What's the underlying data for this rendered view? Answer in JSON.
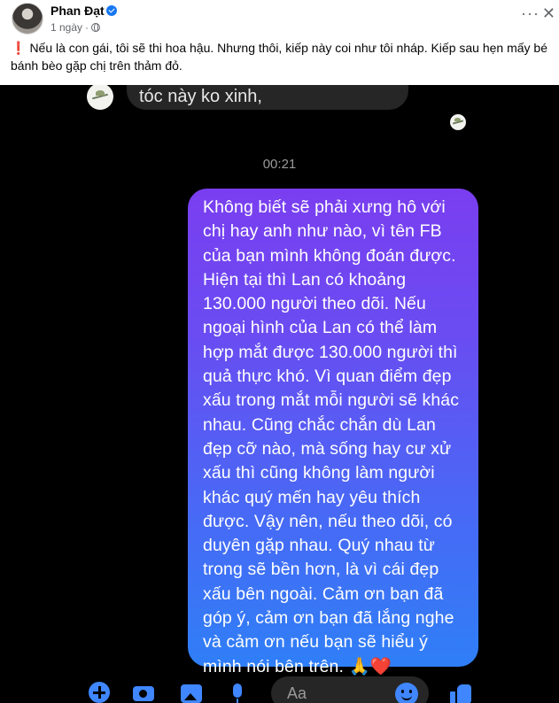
{
  "post": {
    "author": "Phan Đạt",
    "time": "1 ngày",
    "separator": "·",
    "more_icon": "more-horizontal-icon",
    "close_icon": "close-icon",
    "caption_emoji": "❗",
    "caption": "Nếu là con gái, tôi sẽ thi hoa hậu. Nhưng thôi, kiếp này coi như tôi nháp. Kiếp sau hẹn mấy bé bánh bèo gặp chị trên thảm đỏ."
  },
  "chat": {
    "incoming_message": "tóc này ko xinh,",
    "timestamp": "00:21",
    "outgoing_message": "Không biết sẽ phải xưng hô với chị hay anh như nào, vì tên FB của bạn mình không đoán được. Hiện tại thì Lan có khoảng 130.000 người theo dõi.  Nếu ngoại hình của Lan có thể làm hợp mắt được 130.000 người thì quả thực khó. Vì quan điểm đẹp xấu trong mắt mỗi người sẽ khác nhau. Cũng chắc chắn dù Lan đẹp cỡ nào, mà sống hay cư xử xấu thì cũng không làm người khác quý mến hay yêu thích được. Vậy nên, nếu theo dõi, có duyên gặp nhau. Quý nhau từ trong sẽ bền hơn, là vì cái đẹp xấu bên ngoài. Cảm ơn bạn đã góp ý, cảm ơn bạn đã lắng nghe và cảm ơn nếu bạn sẽ hiểu ý mình nói bên trên. 🙏❤️",
    "bubble_gradient": [
      "#7a3ef0",
      "#2f7ff7"
    ],
    "input_placeholder": "Aa",
    "composer_icons": [
      "plus-icon",
      "camera-icon",
      "image-icon",
      "mic-icon",
      "emoji-icon",
      "like-icon"
    ],
    "accent_color": "#3f86ff"
  }
}
